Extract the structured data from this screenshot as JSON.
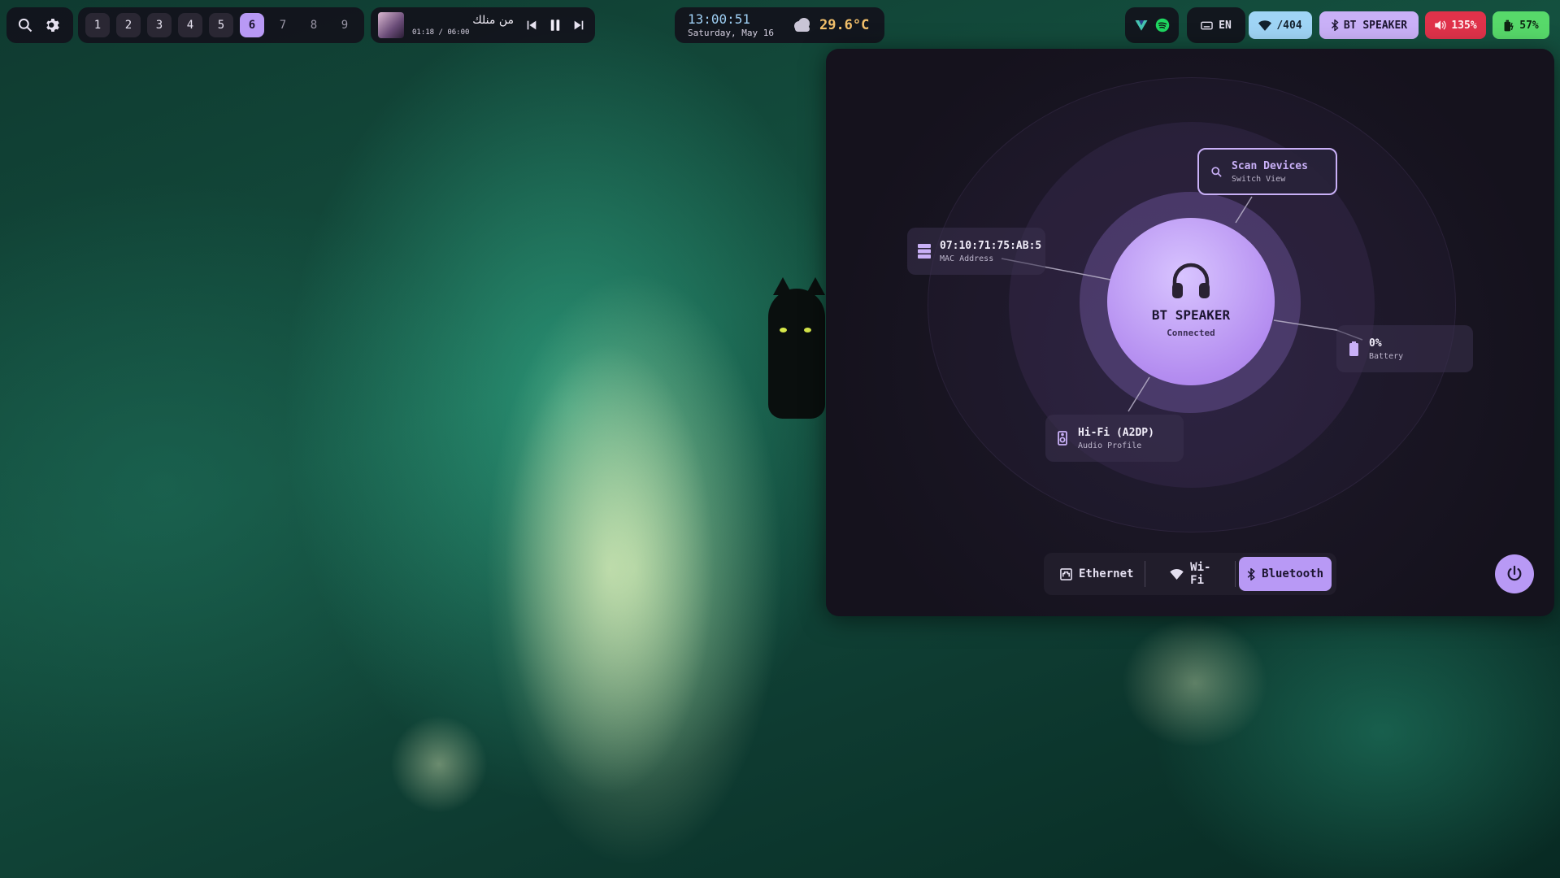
{
  "colors": {
    "accent": "#b899f5",
    "clock_blue": "#9fd0f5",
    "temp_orange": "#f3c06b",
    "wifi_chip": "#9fd4f5",
    "bt_chip": "#c9b0f7",
    "volume_chip": "#e0324a",
    "battery_chip": "#57d96a"
  },
  "topbar": {
    "search_icon": "search-icon",
    "settings_icon": "gear-icon",
    "workspaces": [
      {
        "label": "1",
        "state": "occupied"
      },
      {
        "label": "2",
        "state": "occupied"
      },
      {
        "label": "3",
        "state": "occupied"
      },
      {
        "label": "4",
        "state": "occupied"
      },
      {
        "label": "5",
        "state": "occupied"
      },
      {
        "label": "6",
        "state": "active"
      },
      {
        "label": "7",
        "state": "empty"
      },
      {
        "label": "8",
        "state": "empty"
      },
      {
        "label": "9",
        "state": "empty"
      }
    ],
    "media": {
      "title": "من منلك",
      "time": "01:18 / 06:00",
      "prev_icon": "skip-previous-icon",
      "pause_icon": "pause-icon",
      "next_icon": "skip-next-icon"
    },
    "clock": {
      "time": "13:00:51",
      "date": "Saturday, May 16"
    },
    "weather": {
      "icon": "cloud-icon",
      "temp": "29.6°C"
    },
    "tray": {
      "vpn_icon": "vpn-icon",
      "spotify_icon": "spotify-icon"
    },
    "keyboard": {
      "icon": "keyboard-icon",
      "label": "EN"
    },
    "wifi": {
      "icon": "wifi-icon",
      "label": "/404"
    },
    "bluetooth": {
      "icon": "bluetooth-icon",
      "label": "BT SPEAKER"
    },
    "volume": {
      "icon": "volume-icon",
      "label": "135%"
    },
    "battery": {
      "icon": "battery-charging-icon",
      "label": "57%"
    }
  },
  "panel": {
    "device": {
      "name": "BT SPEAKER",
      "status": "Connected",
      "icon": "headphones-icon"
    },
    "scan": {
      "title": "Scan Devices",
      "subtitle": "Switch View"
    },
    "mac": {
      "title": "07:10:71:75:AB:5",
      "subtitle": "MAC Address"
    },
    "battery": {
      "title": "0%",
      "subtitle": "Battery"
    },
    "profile": {
      "title": "Hi-Fi (A2DP)",
      "subtitle": "Audio Profile"
    },
    "tabs": [
      {
        "label": "Ethernet",
        "icon": "ethernet-icon"
      },
      {
        "label": "Wi-Fi",
        "icon": "wifi-icon"
      },
      {
        "label": "Bluetooth",
        "icon": "bluetooth-icon",
        "active": true
      }
    ],
    "power_icon": "power-icon"
  }
}
